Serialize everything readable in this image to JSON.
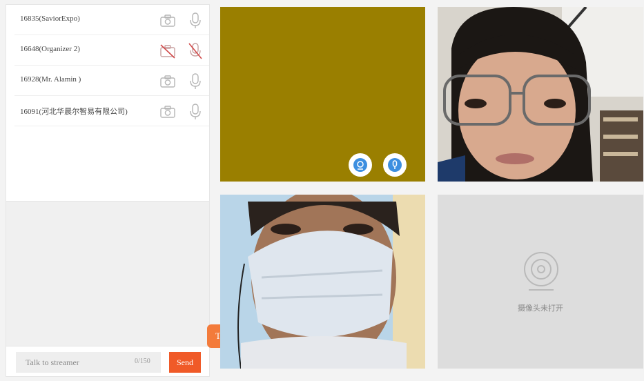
{
  "participants": [
    {
      "name": "16835(SaviorExpo)",
      "camera": "on",
      "mic": "on"
    },
    {
      "name": "16648(Organizer 2)",
      "camera": "off",
      "mic": "off"
    },
    {
      "name": "16928(Mr. Alamin )",
      "camera": "on",
      "mic": "on"
    },
    {
      "name": "16091(河北华晨尔智易有限公司)",
      "camera": "on",
      "mic": "on"
    }
  ],
  "chat": {
    "placeholder": "Talk to streamer",
    "counter": "0/150",
    "send_label": "Send"
  },
  "float_toggle_label": "T",
  "video_tiles": [
    {
      "name": "tile-1",
      "state": "video",
      "color": "#9a7f00"
    },
    {
      "name": "tile-2",
      "state": "video"
    },
    {
      "name": "tile-3",
      "state": "video"
    },
    {
      "name": "tile-4",
      "state": "camera-off",
      "message": "摄像头未打开"
    }
  ],
  "colors": {
    "accent": "#f05a28",
    "toggle": "#f37b3b",
    "icon_blue": "#3d8fe0",
    "disabled_red": "#d24a4a"
  },
  "icons": [
    "camera-icon",
    "microphone-icon",
    "camera-off-icon",
    "microphone-off-icon",
    "webcam-icon"
  ]
}
